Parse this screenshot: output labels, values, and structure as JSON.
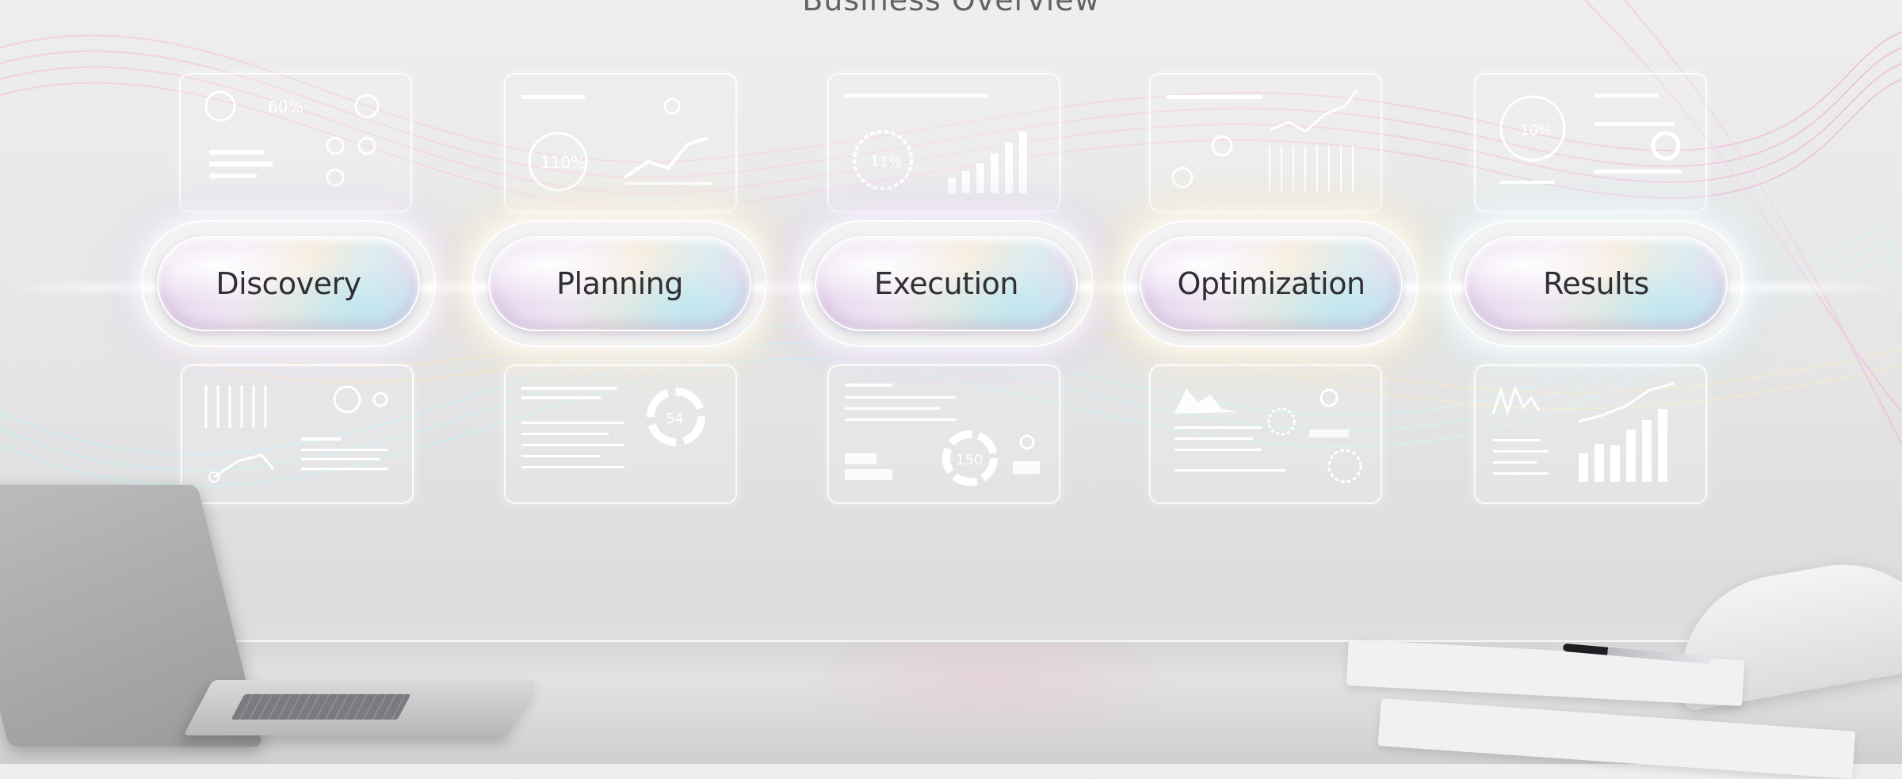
{
  "title": "Business Overview",
  "stages": [
    {
      "label": "Discovery",
      "accent": "#d7c0ea"
    },
    {
      "label": "Planning",
      "accent": "#f4dfb0"
    },
    {
      "label": "Execution",
      "accent": "#cdb6e6"
    },
    {
      "label": "Optimization",
      "accent": "#f2dca6"
    },
    {
      "label": "Results",
      "accent": "#c9e6ef"
    }
  ],
  "panels": {
    "top": [
      {
        "readout": "60%"
      },
      {
        "readout": "110%"
      },
      {
        "readout": "11%"
      },
      {
        "readout": ""
      },
      {
        "readout": "10%"
      }
    ],
    "bottom": [
      {
        "readout": ""
      },
      {
        "readout": "54"
      },
      {
        "readout": "150"
      },
      {
        "readout": ""
      },
      {
        "readout": ""
      }
    ]
  },
  "icons": [
    "laptop-icon",
    "pen-icon",
    "chair-icon"
  ],
  "colors": {
    "wave_pink": "#f2b6d8",
    "wave_cyan": "#b6e9f3",
    "wave_gold": "#f3dcae",
    "background": "#e8e8e8"
  }
}
